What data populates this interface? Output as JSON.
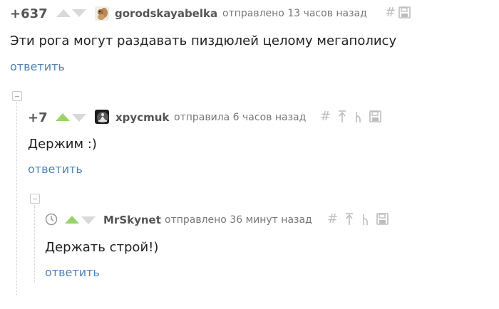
{
  "comments": [
    {
      "rating": "+637",
      "username": "gorodskayabelka",
      "meta": "отправлено 13 часов назад",
      "text": "Эти рога могут раздавать пиздюлей целому мегаполису",
      "reply": "ответить",
      "avatar_icon": "squirrel-avatar-icon"
    },
    {
      "rating": "+7",
      "username": "хpycmuk",
      "meta": "отправила 6 часов назад",
      "text": "Держим :)",
      "reply": "ответить",
      "avatar_icon": "meditation-avatar-icon"
    },
    {
      "rating": "",
      "username": "MrSkynet",
      "meta": "отправлено 36 минут назад",
      "text": "Держать строй!)",
      "reply": "ответить",
      "avatar_icon": "clock-icon"
    }
  ],
  "colors": {
    "upvote_active": "#9bd36a",
    "vote_inactive": "#d9d9d9",
    "link": "#4f83b6",
    "icon_gray": "#bdbdbd"
  }
}
